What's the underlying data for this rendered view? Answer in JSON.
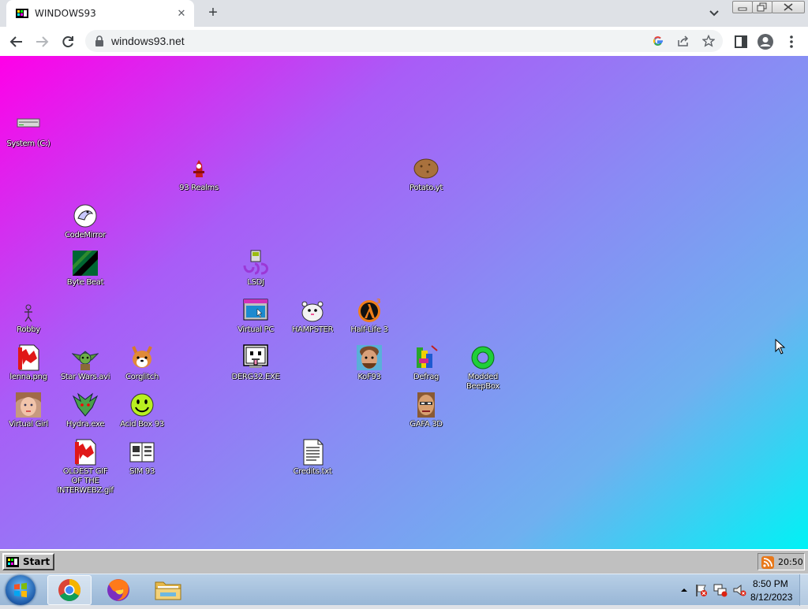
{
  "browser": {
    "tab_title": "WINDOWS93",
    "tab_close": "✕",
    "newtab": "+",
    "url": "windows93.net"
  },
  "desktop_icons": [
    {
      "label": "System (C:)",
      "icon": "drive-icon"
    },
    {
      "label": "93 Realms",
      "icon": "realms-icon"
    },
    {
      "label": "Potato.yt",
      "icon": "potato-icon"
    },
    {
      "label": "CodeMirror",
      "icon": "codemirror-icon"
    },
    {
      "label": "Byte Beat",
      "icon": "bytebeat-icon"
    },
    {
      "label": "LSDJ",
      "icon": "lsdj-icon"
    },
    {
      "label": "Robby",
      "icon": "robby-icon"
    },
    {
      "label": "Virtual PC",
      "icon": "virtualpc-icon"
    },
    {
      "label": "HAMPSTER",
      "icon": "hampster-icon"
    },
    {
      "label": "Half-Life 3",
      "icon": "halflife-icon"
    },
    {
      "label": "lenna.png",
      "icon": "image-file-icon"
    },
    {
      "label": "Star Wars.avi",
      "icon": "yoda-icon"
    },
    {
      "label": "Corglitch",
      "icon": "corgi-icon"
    },
    {
      "label": "DERG32.EXE",
      "icon": "derg-icon"
    },
    {
      "label": "KoF93",
      "icon": "kof-icon"
    },
    {
      "label": "Defrag",
      "icon": "defrag-icon"
    },
    {
      "label": "Modded BeepBox",
      "icon": "beepbox-icon"
    },
    {
      "label": "Virtual Girl",
      "icon": "virtualgirl-icon"
    },
    {
      "label": "Hydra.exe",
      "icon": "hydra-icon"
    },
    {
      "label": "Acid Box 93",
      "icon": "smiley-icon"
    },
    {
      "label": "GAFA 3D",
      "icon": "gafa-icon"
    },
    {
      "label": "OLDEST GIF OF THE INTERWEBZ.gif",
      "icon": "gif-file-icon"
    },
    {
      "label": "SIM 93",
      "icon": "sim-icon"
    },
    {
      "label": "Credits.txt",
      "icon": "text-file-icon"
    }
  ],
  "w93_taskbar": {
    "start_label": "Start",
    "clock": "20:50"
  },
  "win7_taskbar": {
    "time": "8:50 PM",
    "date": "8/12/2023"
  }
}
